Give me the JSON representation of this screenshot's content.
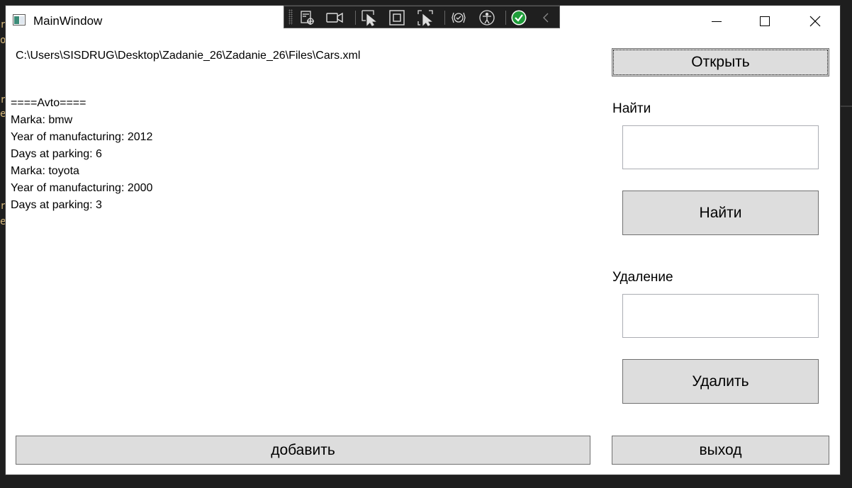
{
  "window": {
    "title": "MainWindow"
  },
  "desktop_glyphs": [
    "r",
    "o",
    "r",
    "e",
    "r",
    "e"
  ],
  "file_path": "C:\\Users\\SISDRUG\\Desktop\\Zadanie_26\\Zadanie_26\\Files\\Cars.xml",
  "output": {
    "lines": [
      "====Avto====",
      "Marka: bmw",
      "Year of manufacturing: 2012",
      "Days at parking: 6",
      "Marka: toyota",
      "Year of manufacturing: 2000",
      "Days at parking: 3"
    ]
  },
  "buttons": {
    "open": "Открыть",
    "find": "Найти",
    "delete": "Удалить",
    "add": "добавить",
    "exit": "выход"
  },
  "labels": {
    "find": "Найти",
    "delete": "Удаление"
  },
  "inputs": {
    "find_value": "",
    "delete_value": ""
  },
  "toolbar_icons": [
    "select-element-icon",
    "record-icon",
    "select-element-pointer-icon",
    "display-layout-adorners-icon",
    "track-focused-element-icon",
    "hot-reload-icon",
    "accessibility-icon",
    "binding-check-icon",
    "collapse-toolbar-icon"
  ]
}
